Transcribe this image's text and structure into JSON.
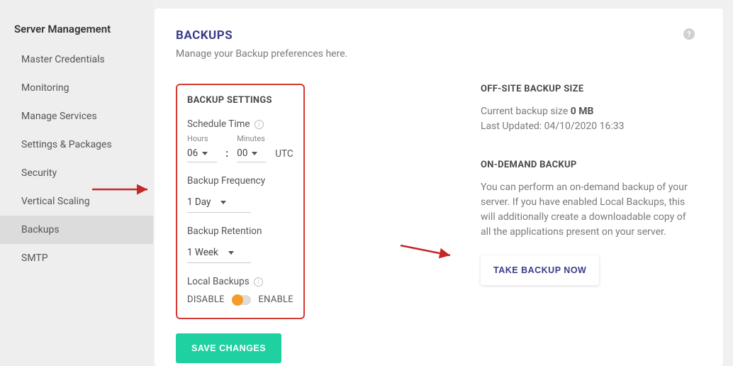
{
  "sidebar": {
    "title": "Server Management",
    "items": [
      {
        "label": "Master Credentials"
      },
      {
        "label": "Monitoring"
      },
      {
        "label": "Manage Services"
      },
      {
        "label": "Settings & Packages"
      },
      {
        "label": "Security"
      },
      {
        "label": "Vertical Scaling"
      },
      {
        "label": "Backups"
      },
      {
        "label": "SMTP"
      }
    ]
  },
  "page": {
    "title": "BACKUPS",
    "subtitle": "Manage your Backup preferences here.",
    "help_tooltip": "?"
  },
  "settings": {
    "heading": "BACKUP SETTINGS",
    "schedule_time_label": "Schedule Time",
    "hours_label": "Hours",
    "hours_value": "06",
    "minutes_label": "Minutes",
    "minutes_value": "00",
    "tz": "UTC",
    "frequency_label": "Backup Frequency",
    "frequency_value": "1 Day",
    "retention_label": "Backup Retention",
    "retention_value": "1 Week",
    "local_label": "Local Backups",
    "disable_label": "DISABLE",
    "enable_label": "ENABLE",
    "save_label": "SAVE CHANGES"
  },
  "offsite": {
    "heading": "OFF-SITE BACKUP SIZE",
    "size_prefix": "Current backup size ",
    "size_value": "0 MB",
    "updated_prefix": "Last Updated: ",
    "updated_value": "04/10/2020 16:33"
  },
  "ondemand": {
    "heading": "ON-DEMAND BACKUP",
    "desc": "You can perform an on-demand backup of your server. If you have enabled Local Backups, this will additionally create a downloadable copy of all the applications present on your server.",
    "button": "TAKE BACKUP NOW"
  }
}
